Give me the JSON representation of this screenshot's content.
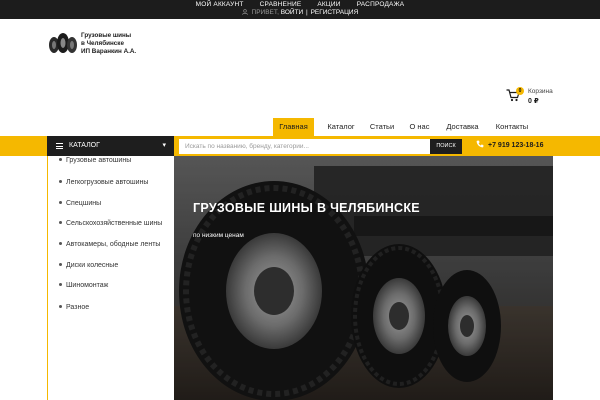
{
  "topbar": {
    "links": [
      "МОЙ АККАУНТ",
      "СРАВНЕНИЕ",
      "АКЦИИ",
      "РАСПРОДАЖА"
    ],
    "greeting": "ПРИВЕТ,",
    "login": "ВОЙТИ",
    "separator": "|",
    "register": "РЕГИСТРАЦИЯ"
  },
  "logo": {
    "line1": "Грузовые шины",
    "line2": "в Челябинске",
    "line3": "ИП Варанкин А.А."
  },
  "cart": {
    "count": "0",
    "label": "Корзина",
    "total": "0 ₽"
  },
  "nav": {
    "items": [
      "Главная",
      "Каталог",
      "Статьи",
      "О нас",
      "Доставка",
      "Контакты"
    ],
    "active_index": 0
  },
  "catalog": {
    "button_label": "КАТАЛОГ",
    "items": [
      "Грузовые автошины",
      "Легкогрузовые автошины",
      "Спецшины",
      "Сельскохозяйственные шины",
      "Автокамеры, ободные ленты",
      "Диски колесные",
      "Шиномонтаж",
      "Разное"
    ]
  },
  "search": {
    "placeholder": "Искать по названию, бренду, категории...",
    "button": "ПОИСК"
  },
  "phone": "+7 919 123-18-16",
  "hero": {
    "title": "ГРУЗОВЫЕ ШИНЫ В ЧЕЛЯБИНСКЕ",
    "subtitle": "по низким ценам"
  },
  "colors": {
    "accent": "#f5b800",
    "dark": "#1e1e1e",
    "topbar": "#1c1c1c"
  }
}
